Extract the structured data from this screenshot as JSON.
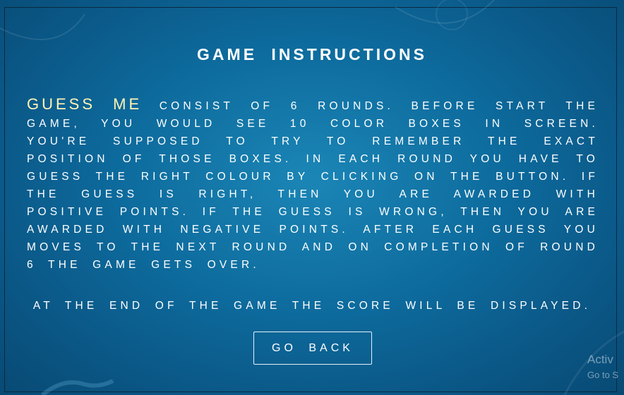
{
  "page": {
    "title": "GAME INSTRUCTIONS",
    "intro_highlight": "GUESS ME",
    "intro_rest": " consist of 6 rounds. Before start the game, you would see 10 color boxes in screen. You're supposed to try to remember the exact position of those boxes. In each round you have to guess the right colour by clicking on the button. If the guess is right, then you are awarded with positive points. If the guess is wrong, then you are awarded with negative points. After each guess you moves to the next round and on completion of round 6 the game gets over.",
    "end_text": "At the end of the game the score will be displayed.",
    "back_button_label": "GO BACK"
  },
  "watermark": {
    "line1": "Activ",
    "line2": "Go to S"
  },
  "colors": {
    "background": "#0d6a9c",
    "highlight": "#fff3b8",
    "text": "#ffffff"
  }
}
